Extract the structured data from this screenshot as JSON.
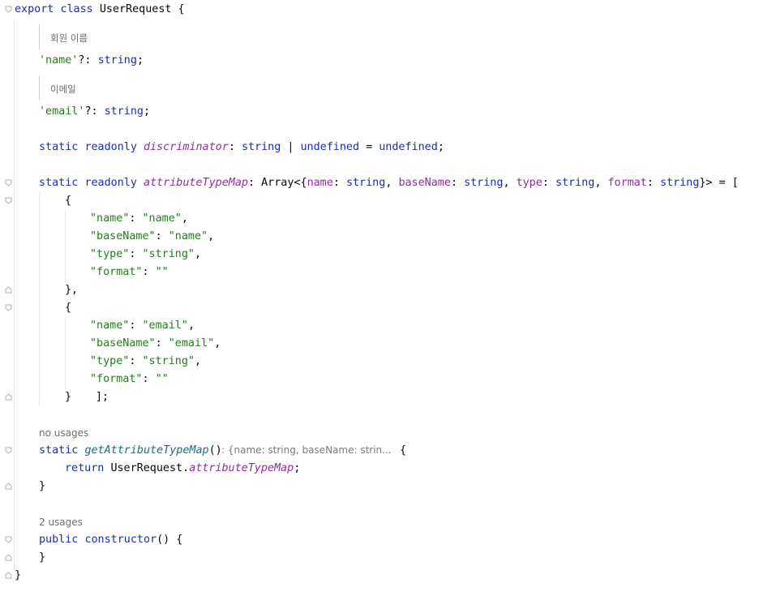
{
  "code": {
    "export_kw": "export",
    "class_kw": "class",
    "class_name": "UserRequest",
    "open_brace": " {",
    "doc_name": "회원 이름",
    "name_prop": "'name'",
    "q_colon": "?: ",
    "type_string": "string",
    "semi": ";",
    "doc_email": "이메일",
    "email_prop": "'email'",
    "static_kw": "static",
    "readonly_kw": "readonly",
    "discriminator": "discriminator",
    "colon_sp": ": ",
    "pipe": " | ",
    "undefined_kw": "undefined",
    "eq": " = ",
    "attribute_type_map": "attributeTypeMap",
    "array_open": "Array<{",
    "k_name": "name",
    "k_baseName": "baseName",
    "k_type": "type",
    "k_format": "format",
    "comma_sp": ", ",
    "array_close": "}> = [",
    "brace_open": "{",
    "brace_close_comma": "},",
    "brace_close": "}",
    "array_end": "];",
    "s_name_key": "\"name\"",
    "s_name_val": "\"name\"",
    "s_baseName_key": "\"baseName\"",
    "s_type_key": "\"type\"",
    "s_string_val": "\"string\"",
    "s_format_key": "\"format\"",
    "s_empty": "\"\"",
    "s_email_val": "\"email\"",
    "comma": ",",
    "no_usages": "no usages",
    "get_fn": "getAttributeTypeMap",
    "parens": "()",
    "inlay_hint": ": {name: string, baseName: strin...",
    "return_kw": "return",
    "user_request_dot": "UserRequest.",
    "two_usages": "2 usages",
    "public_kw": "public",
    "constructor_kw": "constructor",
    "ctor_tail": "() {"
  }
}
